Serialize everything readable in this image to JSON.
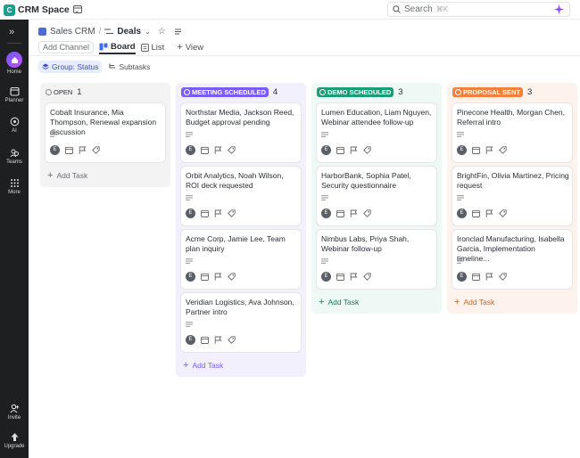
{
  "workspace": {
    "initial": "C",
    "name": "CRM Space"
  },
  "search": {
    "placeholder": "Search",
    "shortcut": "⌘K"
  },
  "rail": [
    {
      "label": "Home",
      "icon": "home-icon"
    },
    {
      "label": "Planner",
      "icon": "calendar-icon"
    },
    {
      "label": "AI",
      "icon": "ai-icon"
    },
    {
      "label": "Teams",
      "icon": "teams-icon"
    },
    {
      "label": "More",
      "icon": "grid-icon"
    },
    {
      "label": "Invite",
      "icon": "invite-icon"
    },
    {
      "label": "Upgrade",
      "icon": "upgrade-icon"
    }
  ],
  "breadcrumb": {
    "parent": "Sales CRM",
    "current": "Deals"
  },
  "views": {
    "add_channel": "Add Channel",
    "board": "Board",
    "list": "List",
    "add_view": "View"
  },
  "filters": {
    "group": "Group: Status",
    "subtasks": "Subtasks"
  },
  "colors": {
    "open": "#f3f3f4",
    "meeting": "#7b5cff",
    "demo": "#1b9e77",
    "proposal": "#f4813b"
  },
  "columns": [
    {
      "status": "OPEN",
      "count": "1",
      "add_task": "Add Task",
      "cards": [
        {
          "title": "Cobalt Insurance, Mia Thompson, Renewal expansion discussion",
          "assignee": "E"
        }
      ]
    },
    {
      "status": "MEETING SCHEDULED",
      "count": "4",
      "add_task": "Add Task",
      "cards": [
        {
          "title": "Northstar Media, Jackson Reed, Budget approval pending",
          "assignee": "E"
        },
        {
          "title": "Orbit Analytics, Noah Wilson, ROI deck requested",
          "assignee": "E"
        },
        {
          "title": "Acme Corp, Jamie Lee, Team plan inquiry",
          "assignee": "E"
        },
        {
          "title": "Veridian Logistics, Ava Johnson, Partner intro",
          "assignee": "E"
        }
      ]
    },
    {
      "status": "DEMO SCHEDULED",
      "count": "3",
      "add_task": "Add Task",
      "cards": [
        {
          "title": "Lumen Education, Liam Nguyen, Webinar attendee follow-up",
          "assignee": "E"
        },
        {
          "title": "HarborBank, Sophia Patel, Security questionnaire",
          "assignee": "E"
        },
        {
          "title": "Nimbus Labs, Priya Shah, Webinar follow-up",
          "assignee": "E"
        }
      ]
    },
    {
      "status": "PROPOSAL SENT",
      "count": "3",
      "add_task": "Add Task",
      "cards": [
        {
          "title": "Pinecone Health, Morgan Chen, Referral intro",
          "assignee": "E"
        },
        {
          "title": "BrightFin, Olivia Martinez, Pricing request",
          "assignee": "E"
        },
        {
          "title": "Ironclad Manufacturing, Isabella Garcia, Implementation timeline...",
          "assignee": "E"
        }
      ]
    }
  ]
}
